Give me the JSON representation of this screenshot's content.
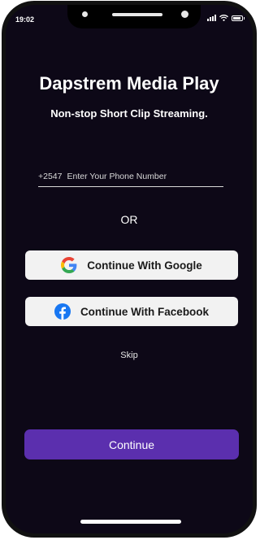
{
  "status_bar": {
    "time": "19:02",
    "icons": [
      "cellular-signal-icon",
      "wifi-icon",
      "battery-icon"
    ]
  },
  "header": {
    "title": "Dapstrem Media Play",
    "subtitle": "Non-stop Short Clip Streaming."
  },
  "phone_input": {
    "prefix": "+2547",
    "placeholder": "Enter Your Phone Number"
  },
  "divider_text": "OR",
  "buttons": {
    "google": {
      "label": "Continue With Google",
      "icon": "google-icon"
    },
    "facebook": {
      "label": "Continue With Facebook",
      "icon": "facebook-icon",
      "color": "#1877F2"
    },
    "skip": "Skip",
    "continue": "Continue"
  },
  "colors": {
    "background": "#0d0817",
    "primary": "#5b2fae",
    "social_button_bg": "#f2f2f2"
  }
}
